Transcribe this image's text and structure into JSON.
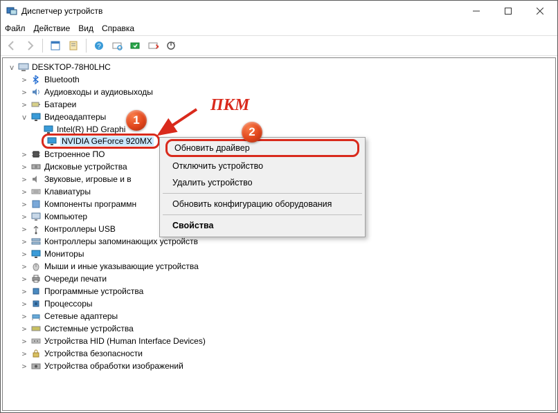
{
  "window": {
    "title": "Диспетчер устройств"
  },
  "menu": {
    "file": "Файл",
    "action": "Действие",
    "view": "Вид",
    "help": "Справка"
  },
  "tree": {
    "root": "DESKTOP-78H0LHC",
    "items": {
      "bluetooth": "Bluetooth",
      "audio": "Аудиовходы и аудиовыходы",
      "batteries": "Батареи",
      "display": "Видеоадаптеры",
      "intel": "Intel(R) HD Graphi",
      "nvidia": "NVIDIA GeForce 920MX",
      "firmware": "Встроенное ПО",
      "disks": "Дисковые устройства",
      "sound": "Звуковые, игровые и в",
      "keyboards": "Клавиатуры",
      "software": "Компоненты программн",
      "computer": "Компьютер",
      "usb": "Контроллеры USB",
      "storage": "Контроллеры запоминающих устройств",
      "monitors": "Мониторы",
      "mice": "Мыши и иные указывающие устройства",
      "print": "Очереди печати",
      "progdev": "Программные устройства",
      "cpu": "Процессоры",
      "net": "Сетевые адаптеры",
      "system": "Системные устройства",
      "hid": "Устройства HID (Human Interface Devices)",
      "security": "Устройства безопасности",
      "imaging": "Устройства обработки изображений"
    }
  },
  "context": {
    "update": "Обновить драйвер",
    "disable": "Отключить устройство",
    "uninstall": "Удалить устройство",
    "scan": "Обновить конфигурацию оборудования",
    "properties": "Свойства"
  },
  "annot": {
    "rmb": "ПКМ",
    "step1": "1",
    "step2": "2"
  }
}
